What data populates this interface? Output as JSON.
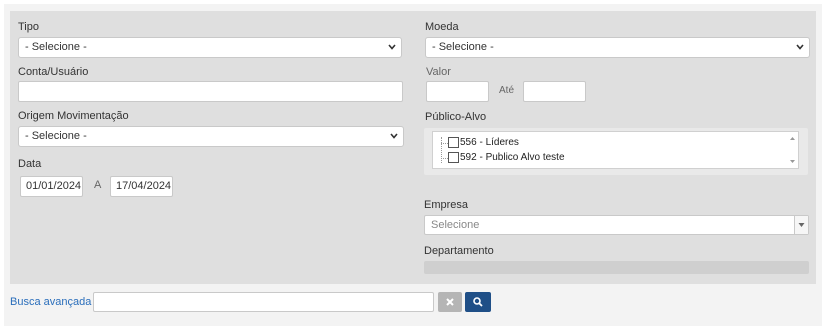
{
  "filters": {
    "tipo": {
      "label": "Tipo",
      "selected": "- Selecione -"
    },
    "moeda": {
      "label": "Moeda",
      "selected": "- Selecione -"
    },
    "conta_usuario": {
      "label": "Conta/Usuário",
      "value": ""
    },
    "valor": {
      "label": "Valor",
      "from_value": "",
      "to_label": "Até",
      "to_value": ""
    },
    "origem": {
      "label": "Origem Movimentação",
      "selected": "- Selecione -"
    },
    "publico_alvo": {
      "label": "Público-Alvo",
      "items": [
        {
          "label": "556 - Líderes",
          "checked": false
        },
        {
          "label": "592 - Publico Alvo teste",
          "checked": false
        }
      ]
    },
    "data": {
      "label": "Data",
      "from": "01/01/2024",
      "separator": "A",
      "to": "17/04/2024"
    },
    "empresa": {
      "label": "Empresa",
      "placeholder": "Selecione"
    },
    "departamento": {
      "label": "Departamento"
    }
  },
  "search": {
    "advanced_label": "Busca avançada",
    "query": "",
    "clear_icon": "times-icon",
    "search_icon": "search-icon"
  },
  "colors": {
    "panel_bg": "#dfdfdf",
    "link": "#2a6ebb",
    "search_button": "#1f4f87",
    "clear_button": "#b5b5b5"
  }
}
